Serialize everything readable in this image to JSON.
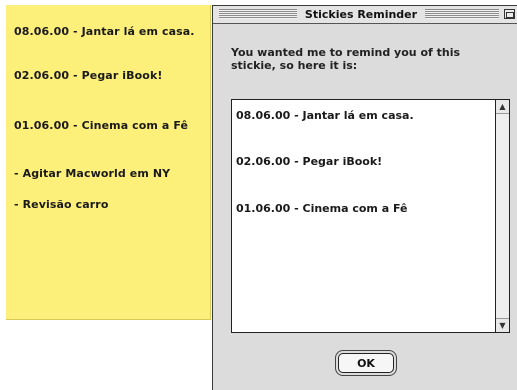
{
  "sticky": {
    "color": "#fdf07a",
    "lines": [
      "08.06.00 - Jantar lá em casa.",
      "02.06.00 - Pegar iBook!",
      "01.06.00 - Cinema com a Fê",
      "- Agitar Macworld em NY",
      "- Revisão carro"
    ]
  },
  "dialog": {
    "title": "Stickies Reminder",
    "message": "You wanted me to remind you of this stickie, so here it is:",
    "content_lines": [
      "08.06.00 - Jantar lá em casa.",
      "02.06.00 - Pegar iBook!",
      "01.06.00 - Cinema com a Fê"
    ],
    "scroll_up_icon": "triangle-up",
    "scroll_down_icon": "triangle-down",
    "ok_label": "OK"
  }
}
